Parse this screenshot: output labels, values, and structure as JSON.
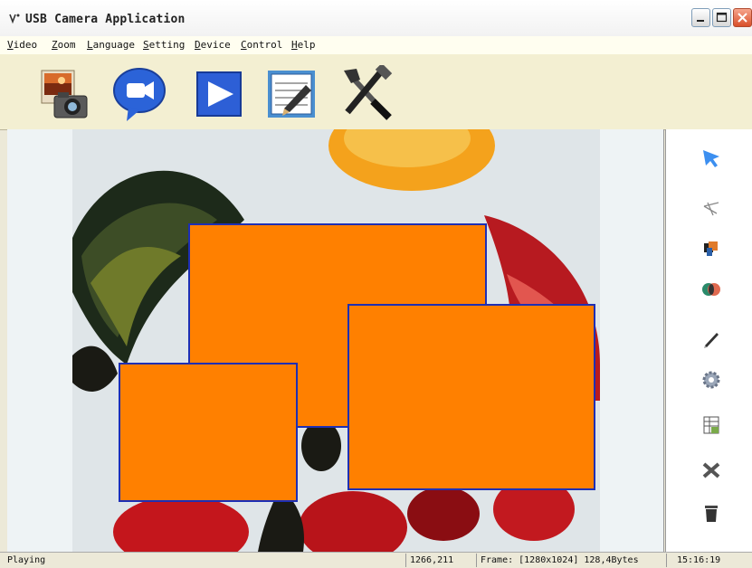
{
  "window": {
    "title": "USB Camera Application",
    "controls": {
      "minimize": "minimize-icon",
      "maximize": "maximize-icon",
      "close": "close-icon"
    }
  },
  "menu": {
    "items": [
      {
        "label": "Video"
      },
      {
        "label": "Zoom"
      },
      {
        "label": "Language"
      },
      {
        "label": "Setting"
      },
      {
        "label": "Device"
      },
      {
        "label": "Control"
      },
      {
        "label": "Help"
      }
    ]
  },
  "toolbar": {
    "buttons": [
      {
        "icon": "photo-camera-icon"
      },
      {
        "icon": "video-chat-icon"
      },
      {
        "icon": "play-icon"
      },
      {
        "icon": "notes-edit-icon"
      },
      {
        "icon": "tools-icon"
      }
    ]
  },
  "preview": {
    "overlay_color": "#ff8000",
    "overlay_border": "#1e2fb4",
    "regions": 4
  },
  "side_tools": [
    {
      "icon": "arrow-cursor-icon"
    },
    {
      "icon": "line-tool-icon"
    },
    {
      "icon": "shapes-icon"
    },
    {
      "icon": "color-circles-icon"
    },
    {
      "icon": "pen-icon"
    },
    {
      "icon": "gear-icon"
    },
    {
      "icon": "grid-edit-icon"
    },
    {
      "icon": "delete-x-icon"
    },
    {
      "icon": "trash-icon"
    }
  ],
  "status": {
    "state": "Playing",
    "coords": "1266,211",
    "frame": "Frame: [1280x1024] 128,4Bytes",
    "time": "15:16:19"
  }
}
